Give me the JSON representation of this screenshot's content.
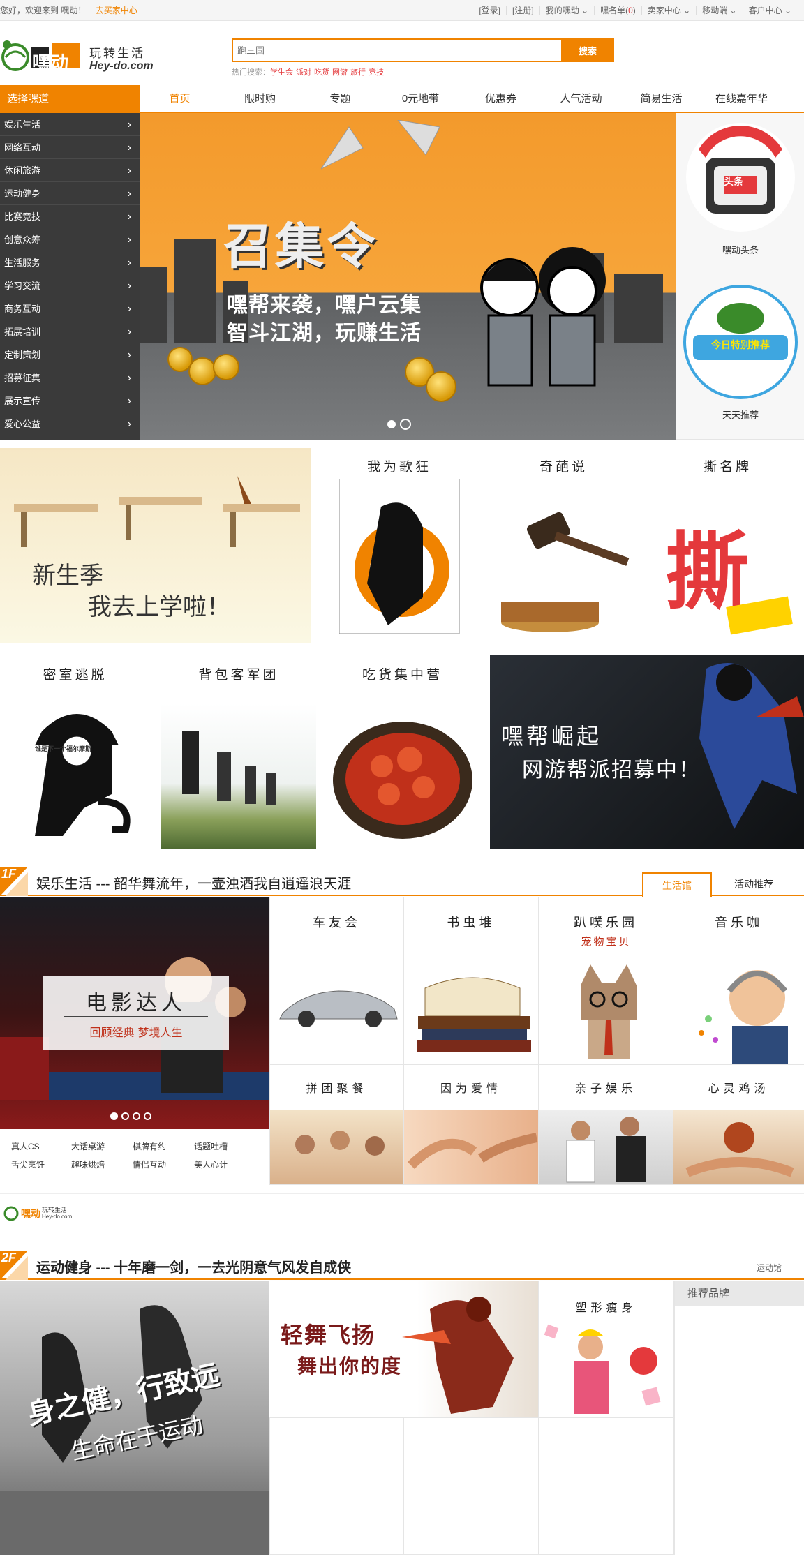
{
  "topbar": {
    "welcome": "您好，欢迎来到 嘿动！",
    "seller_center": "去买家中心",
    "login": "[登录]",
    "register": "[注册]",
    "my_heidong": "我的嘿动",
    "watchlist": "嘿名单(",
    "watchlist_count": "0",
    "watchlist_close": ")",
    "seller": "卖家中心",
    "mobile": "移动端",
    "service": "客户中心"
  },
  "header": {
    "logo_text": "嘿动",
    "logo_slogan": "玩转生活",
    "logo_domain": "Hey-do.com",
    "search_placeholder": "跑三国",
    "search_button": "搜索",
    "hot_label": "热门搜索：",
    "hot_words": [
      "学生会",
      "派对",
      "吃货",
      "网游",
      "旅行",
      "竞技"
    ]
  },
  "nav": {
    "category_label": "选择嘿道",
    "items": [
      "首页",
      "限时购",
      "专题",
      "0元地带",
      "优惠券",
      "人气活动",
      "简易生活",
      "在线嘉年华"
    ]
  },
  "sidebar": {
    "items": [
      "娱乐生活",
      "网络互动",
      "休闲旅游",
      "运动健身",
      "比赛竞技",
      "创意众筹",
      "生活服务",
      "学习交流",
      "商务互动",
      "拓展培训",
      "定制策划",
      "招募征集",
      "展示宣传",
      "爱心公益"
    ]
  },
  "banner": {
    "title": "召集令",
    "subtitle1": "嘿帮来袭，嘿户云集",
    "subtitle2": "智斗江湖，玩赚生活",
    "slide_count": 2,
    "active_slide": 2
  },
  "right_promos": [
    {
      "label": "嘿动头条",
      "badge": "头条"
    },
    {
      "label": "天天推荐",
      "badge": "今日特别推荐"
    }
  ],
  "features": {
    "school": {
      "line1": "新生季",
      "line2": "我去上学啦！"
    },
    "tiles": [
      "我为歌狂",
      "奇葩说",
      "撕名牌",
      "密室逃脱",
      "背包客军团",
      "吃货集中营"
    ],
    "siming_art": "撕",
    "mishi_art": "谁是下一个福尔摩斯",
    "gang": {
      "line1": "嘿帮崛起",
      "line2": "网游帮派招募中！"
    }
  },
  "floor1": {
    "badge": "1F",
    "title": "娱乐生活 --- 韶华舞流年，一壶浊酒我自逍遥浪天涯",
    "tab_active": "生活馆",
    "tab_other": "活动推荐",
    "movie_title": "电影达人",
    "movie_sub": "回顾经典  梦境人生",
    "grid_top": [
      "车友会",
      "书虫堆",
      "趴噗乐园",
      "音乐咖"
    ],
    "pet_sub": "宠物宝贝",
    "grid_bottom": [
      "拼团聚餐",
      "因为爱情",
      "亲子娱乐",
      "心灵鸡汤"
    ],
    "links": [
      "真人CS",
      "大话桌游",
      "棋牌有约",
      "话题吐槽",
      "舌尖烹饪",
      "趣味烘焙",
      "情侣互动",
      "美人心计"
    ]
  },
  "ad_strip": {
    "logo_text": "嘿动",
    "logo_slogan": "玩转生活",
    "logo_domain": "Hey-do.com"
  },
  "floor2": {
    "badge": "2F",
    "title": "运动健身 --- 十年磨一剑，一去光阴意气风发自成侠",
    "tab": "运动馆",
    "hero_line1": "身之健，行致远",
    "hero_line2": "生命在于运动",
    "dance_line1": "轻舞飞扬",
    "dance_line2": "舞出你的度",
    "slim_title": "塑形瘦身",
    "brands_label": "推荐品牌"
  },
  "colors": {
    "accent": "#f08300",
    "hot": "#e4393c",
    "sidebar": "#3a3a3a"
  }
}
